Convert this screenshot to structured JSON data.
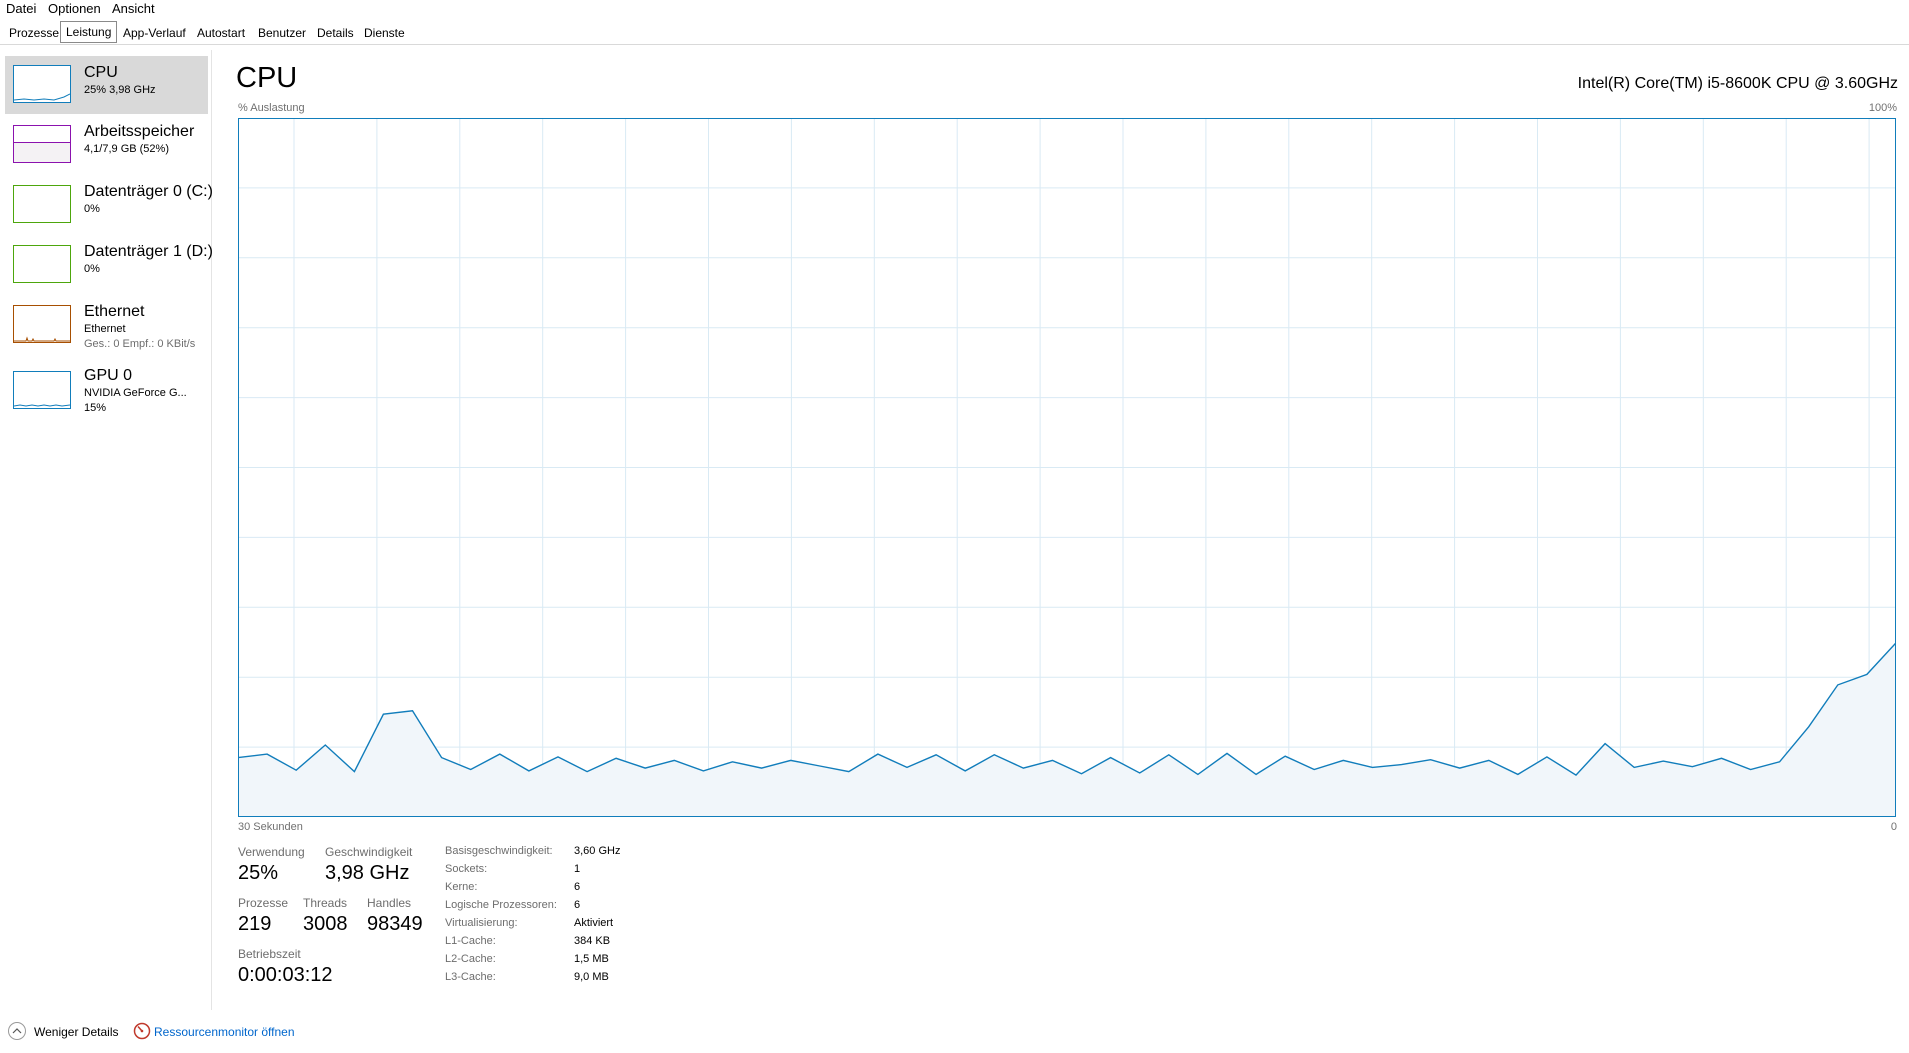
{
  "menu": [
    "Datei",
    "Optionen",
    "Ansicht"
  ],
  "tabs": [
    "Prozesse",
    "Leistung",
    "App-Verlauf",
    "Autostart",
    "Benutzer",
    "Details",
    "Dienste"
  ],
  "active_tab": "Leistung",
  "sidebar": [
    {
      "title": "CPU",
      "line1": "25% 3,98 GHz",
      "line2": "",
      "color": "#117dbb",
      "icon": "cpu-mini-graph"
    },
    {
      "title": "Arbeitsspeicher",
      "line1": "4,1/7,9 GB (52%)",
      "line2": "",
      "color": "#8b12ae",
      "icon": "memory-mini-graph"
    },
    {
      "title": "Datenträger 0 (C:)",
      "line1": "0%",
      "line2": "",
      "color": "#4da60c",
      "icon": "disk-mini-graph"
    },
    {
      "title": "Datenträger 1 (D:)",
      "line1": "0%",
      "line2": "",
      "color": "#4da60c",
      "icon": "disk-mini-graph"
    },
    {
      "title": "Ethernet",
      "line1": "Ethernet",
      "line2": "Ges.: 0 Empf.: 0 KBit/s",
      "color": "#a74f01",
      "icon": "network-mini-graph"
    },
    {
      "title": "GPU 0",
      "line1": "NVIDIA GeForce G...",
      "line2": "15%",
      "color": "#117dbb",
      "icon": "gpu-mini-graph"
    }
  ],
  "main": {
    "title": "CPU",
    "cpu_name": "Intel(R) Core(TM) i5-8600K CPU @ 3.60GHz",
    "graph_label_top_left": "% Auslastung",
    "graph_label_top_right": "100%",
    "graph_label_bottom_left": "30 Sekunden",
    "graph_label_bottom_right": "0"
  },
  "stats": {
    "verwendung_label": "Verwendung",
    "verwendung": "25%",
    "geschwindigkeit_label": "Geschwindigkeit",
    "geschwindigkeit": "3,98 GHz",
    "prozesse_label": "Prozesse",
    "prozesse": "219",
    "threads_label": "Threads",
    "threads": "3008",
    "handles_label": "Handles",
    "handles": "98349",
    "betriebszeit_label": "Betriebszeit",
    "betriebszeit": "0:00:03:12"
  },
  "specs": [
    {
      "label": "Basisgeschwindigkeit:",
      "value": "3,60 GHz"
    },
    {
      "label": "Sockets:",
      "value": "1"
    },
    {
      "label": "Kerne:",
      "value": "6"
    },
    {
      "label": "Logische Prozessoren:",
      "value": "6"
    },
    {
      "label": "Virtualisierung:",
      "value": "Aktiviert"
    },
    {
      "label": "L1-Cache:",
      "value": "384 KB"
    },
    {
      "label": "L2-Cache:",
      "value": "1,5 MB"
    },
    {
      "label": "L3-Cache:",
      "value": "9,0 MB"
    }
  ],
  "footer": {
    "less_details": "Weniger Details",
    "resource_monitor": "Ressourcenmonitor öffnen"
  },
  "colors": {
    "cpu_line": "#117dbb",
    "cpu_fill": "#f1f6fa",
    "grid": "#d9eaf4"
  },
  "chart_data": {
    "type": "area",
    "series": [
      {
        "values": [
          8.5,
          9,
          6.7,
          10.3,
          6.5,
          14.7,
          15.2,
          8.5,
          6.8,
          9,
          6.6,
          8.6,
          6.5,
          8.4,
          7,
          8.1,
          6.6,
          7.9,
          7,
          8.1,
          7.3,
          6.5,
          9,
          7.1,
          8.9,
          6.6,
          8.9,
          7,
          8.1,
          6.2,
          8.5,
          6.3,
          8.9,
          6.1,
          9.1,
          6.1,
          8.7,
          6.8,
          8.1,
          7.1,
          7.5,
          8.2,
          7,
          8.1,
          6.1,
          8.6,
          6,
          10.5,
          7.1,
          8,
          7.2,
          8.4,
          6.8,
          7.9,
          12.9,
          18.9,
          20.4,
          24.9
        ]
      }
    ],
    "ylim": [
      0,
      100
    ],
    "x_label_left": "30 Sekunden",
    "x_label_right": "0",
    "y_label": "% Auslastung",
    "y_max_label": "100%",
    "grid": true
  }
}
